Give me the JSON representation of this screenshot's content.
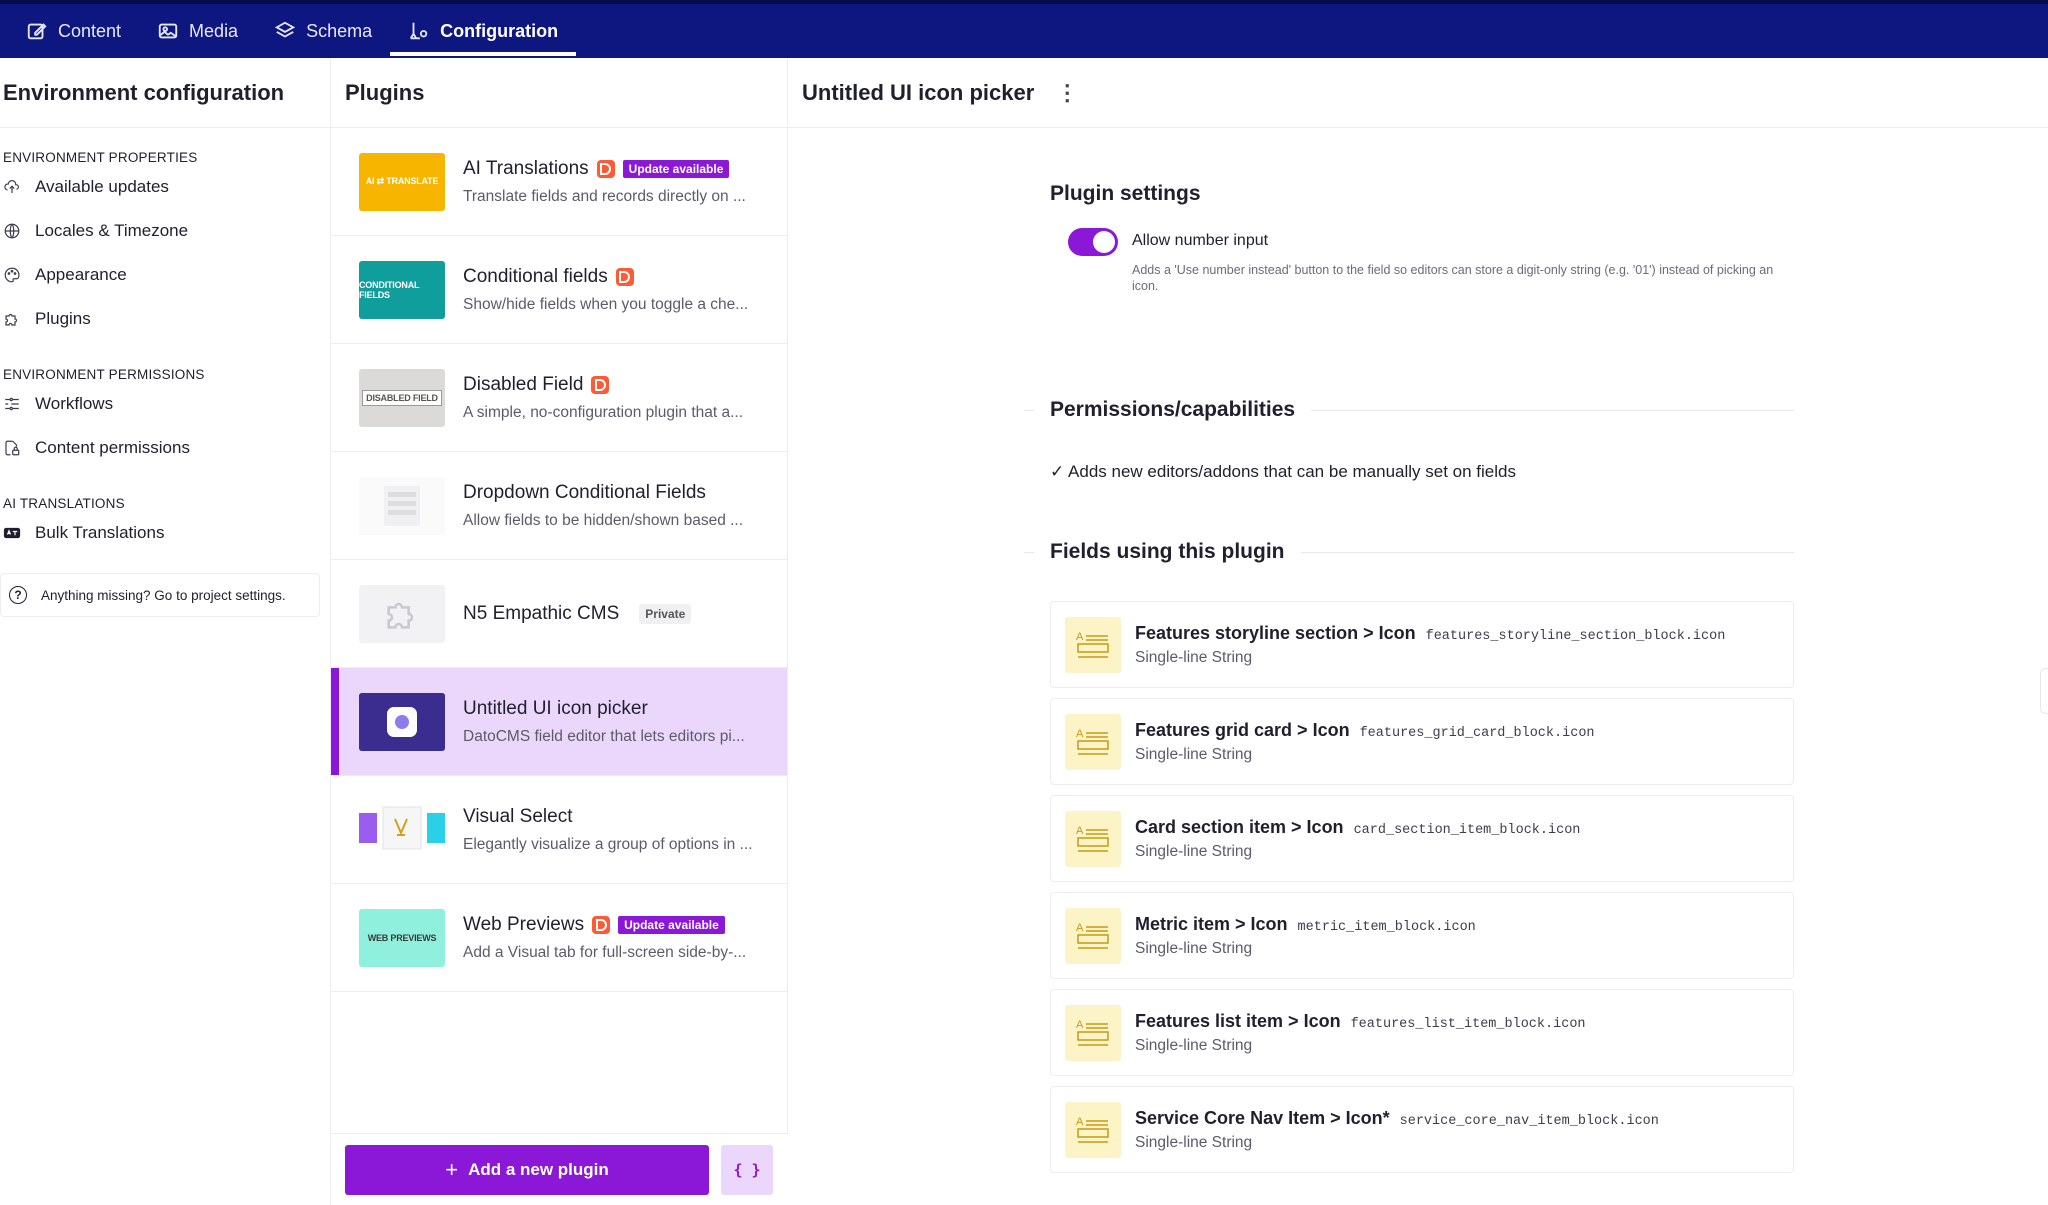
{
  "nav": {
    "tabs": [
      {
        "label": "Content",
        "icon": "edit-icon"
      },
      {
        "label": "Media",
        "icon": "image-icon"
      },
      {
        "label": "Schema",
        "icon": "layers-icon"
      },
      {
        "label": "Configuration",
        "icon": "config-icon",
        "active": true
      }
    ]
  },
  "left": {
    "title": "Environment configuration",
    "sections": [
      {
        "title": "ENVIRONMENT PROPERTIES",
        "items": [
          "Available updates",
          "Locales & Timezone",
          "Appearance",
          "Plugins"
        ]
      },
      {
        "title": "ENVIRONMENT PERMISSIONS",
        "items": [
          "Workflows",
          "Content permissions"
        ]
      },
      {
        "title": "AI TRANSLATIONS",
        "items": [
          "Bulk Translations"
        ]
      }
    ],
    "missing": "Anything missing? Go to project settings."
  },
  "plugins": {
    "title": "Plugins",
    "items": [
      {
        "name": "AI Translations",
        "desc": "Translate fields and records directly on ...",
        "thumb_text": "AI ⇄ TRANSLATE",
        "badge": "Update available"
      },
      {
        "name": "Conditional fields",
        "desc": "Show/hide fields when you toggle a che...",
        "thumb_text": "CONDITIONAL FIELDS"
      },
      {
        "name": "Disabled Field",
        "desc": "A simple, no-configuration plugin that a...",
        "thumb_text": "DISABLED FIELD"
      },
      {
        "name": "Dropdown Conditional Fields",
        "desc": "Allow fields to be hidden/shown based ..."
      },
      {
        "name": "N5 Empathic CMS",
        "desc": "",
        "badge": "Private"
      },
      {
        "name": "Untitled UI icon picker",
        "desc": "DatoCMS field editor that lets editors pi..."
      },
      {
        "name": "Visual Select",
        "desc": "Elegantly visualize a group of options in ..."
      },
      {
        "name": "Web Previews",
        "desc": "Add a Visual tab for full-screen side-by-...",
        "thumb_text": "WEB PREVIEWS",
        "badge": "Update available"
      }
    ],
    "add_label": "Add a new plugin",
    "code_label": "{ }"
  },
  "detail": {
    "title": "Untitled UI icon picker",
    "kebab": "⋮",
    "settings_title": "Plugin settings",
    "toggle_label": "Allow number input",
    "toggle_help": "Adds a 'Use number instead' button to the field so editors can store a digit-only string (e.g. '01') instead of picking an icon.",
    "perm_title": "Permissions/capabilities",
    "perm_line": "✓ Adds new editors/addons that can be manually set on fields",
    "fields_title": "Fields using this plugin",
    "fields": [
      {
        "name": "Features storyline section > Icon",
        "api": "features_storyline_section_block.icon",
        "type": "Single-line String"
      },
      {
        "name": "Features grid card > Icon",
        "api": "features_grid_card_block.icon",
        "type": "Single-line String"
      },
      {
        "name": "Card section item > Icon",
        "api": "card_section_item_block.icon",
        "type": "Single-line String"
      },
      {
        "name": "Metric item > Icon",
        "api": "metric_item_block.icon",
        "type": "Single-line String"
      },
      {
        "name": "Features list item > Icon",
        "api": "features_list_item_block.icon",
        "type": "Single-line String"
      },
      {
        "name": "Service Core Nav Item > Icon*",
        "api": "service_core_nav_item_block.icon",
        "type": "Single-line String"
      }
    ]
  },
  "colors": {
    "nav_bg": "#0e1780",
    "accent": "#8a18d6",
    "selected_bg": "#ead7fb",
    "dato_badge": "#ff5a36"
  }
}
